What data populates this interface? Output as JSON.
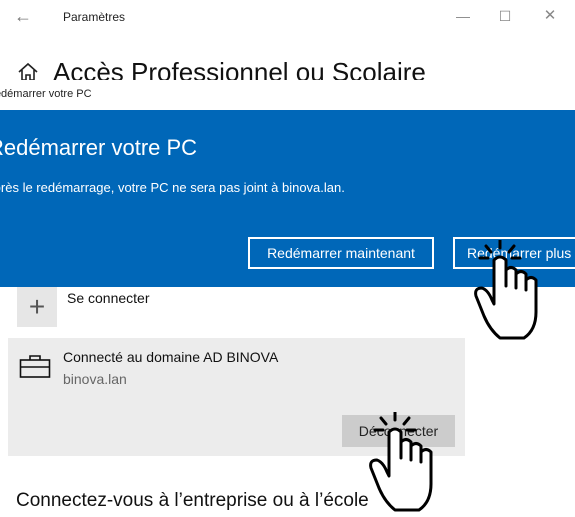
{
  "window": {
    "app_title": "Paramètres",
    "page_title": "Accès Professionnel ou Scolaire",
    "back_icon": "back-arrow-icon",
    "controls": [
      "minimize-icon",
      "maximize-icon",
      "close-icon"
    ]
  },
  "dialog": {
    "title": "Redémarrer votre PC",
    "heading": "Redémarrer votre PC",
    "message": "Après le redémarrage, votre PC ne sera pas joint à binova.lan.",
    "buttons": {
      "restart_now": "Redémarrer maintenant",
      "restart_later": "Redémarrer plus tard"
    },
    "accent_color": "#0067b8"
  },
  "content": {
    "connect_label": "Se connecter",
    "account": {
      "title": "Connecté au domaine AD BINOVA",
      "subtitle": "binova.lan",
      "disconnect_label": "Déconnecter"
    },
    "section_title": "Connectez-vous à l’entreprise ou à l’école"
  },
  "cursors": [
    "hand-pointer-icon",
    "hand-pointer-icon"
  ]
}
